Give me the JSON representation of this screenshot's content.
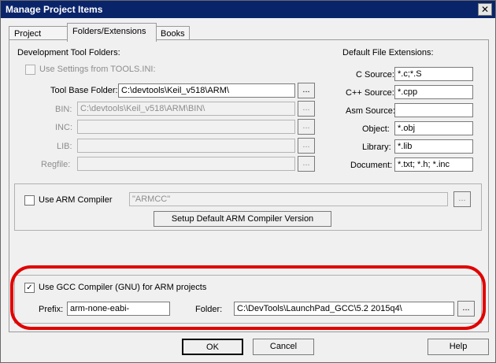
{
  "window": {
    "title": "Manage Project Items",
    "close_symbol": "✕"
  },
  "tabs": [
    {
      "label": "Project Items"
    },
    {
      "label": "Folders/Extensions"
    },
    {
      "label": "Books"
    }
  ],
  "dev_tools": {
    "group_label": "Development Tool Folders:",
    "use_settings": {
      "label": "Use Settings from TOOLS.INI:"
    },
    "tool_base_folder": {
      "label": "Tool Base Folder:",
      "value": "C:\\devtools\\Keil_v518\\ARM\\"
    },
    "bin": {
      "label": "BIN:",
      "value": "C:\\devtools\\Keil_v518\\ARM\\BIN\\"
    },
    "inc": {
      "label": "INC:",
      "value": ""
    },
    "lib": {
      "label": "LIB:",
      "value": ""
    },
    "regfile": {
      "label": "Regfile:",
      "value": ""
    },
    "browse_label": "..."
  },
  "extensions": {
    "group_label": "Default File Extensions:",
    "items": [
      {
        "label": "C Source:",
        "value": "*.c;*.S"
      },
      {
        "label": "C++ Source:",
        "value": "*.cpp"
      },
      {
        "label": "Asm Source:",
        "value": ""
      },
      {
        "label": "Object:",
        "value": "*.obj"
      },
      {
        "label": "Library:",
        "value": "*.lib"
      },
      {
        "label": "Document:",
        "value": "*.txt; *.h; *.inc"
      }
    ]
  },
  "arm_compiler": {
    "checkbox_label": "Use ARM Compiler",
    "value": "\"ARMCC\"",
    "setup_button": "Setup Default ARM Compiler Version",
    "browse_label": "..."
  },
  "gcc": {
    "checkbox_label": "Use GCC Compiler (GNU) for ARM projects",
    "checked": true,
    "prefix_label": "Prefix:",
    "prefix_value": "arm-none-eabi-",
    "folder_label": "Folder:",
    "folder_value": "C:\\DevTools\\LaunchPad_GCC\\5.2 2015q4\\",
    "browse_label": "...",
    "check_mark": "✓"
  },
  "buttons": {
    "ok": "OK",
    "cancel": "Cancel",
    "help": "Help"
  },
  "colors": {
    "highlight_ring": "#e00000",
    "titlebar": "#0a246a"
  }
}
